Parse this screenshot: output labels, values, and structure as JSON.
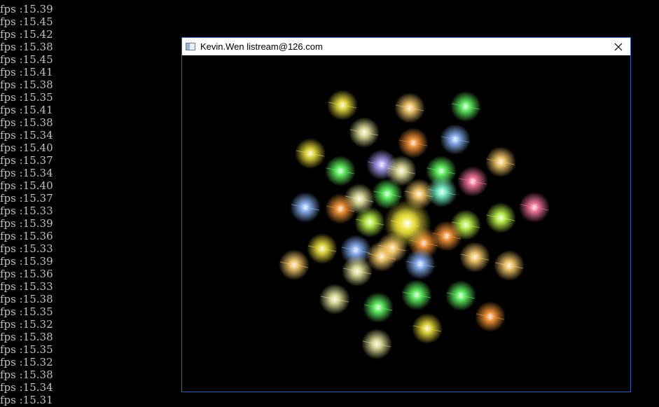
{
  "console": {
    "lines": [
      "fps :15.39",
      "fps :15.45",
      "fps :15.42",
      "fps :15.38",
      "fps :15.45",
      "fps :15.41",
      "fps :15.38",
      "fps :15.35",
      "fps :15.41",
      "fps :15.38",
      "fps :15.34",
      "fps :15.40",
      "fps :15.37",
      "fps :15.34",
      "fps :15.40",
      "fps :15.37",
      "fps :15.33",
      "fps :15.39",
      "fps :15.36",
      "fps :15.33",
      "fps :15.39",
      "fps :15.36",
      "fps :15.33",
      "fps :15.38",
      "fps :15.35",
      "fps :15.32",
      "fps :15.38",
      "fps :15.35",
      "fps :15.32",
      "fps :15.38",
      "fps :15.34",
      "fps :15.31"
    ]
  },
  "window": {
    "title": "Kevin.Wen listream@126.com",
    "icon": "application-window-icon",
    "close_icon": "close-icon",
    "border_color": "#2f5eb8"
  },
  "scene": {
    "background": "#000000",
    "particle_colors": [
      "#f2e640",
      "#c8ff50",
      "#66ff66",
      "#ff9a3a",
      "#ff7aa0",
      "#8fb8ff",
      "#b0a8ff",
      "#ffd070",
      "#e8e8a0",
      "#80ffd0"
    ]
  }
}
